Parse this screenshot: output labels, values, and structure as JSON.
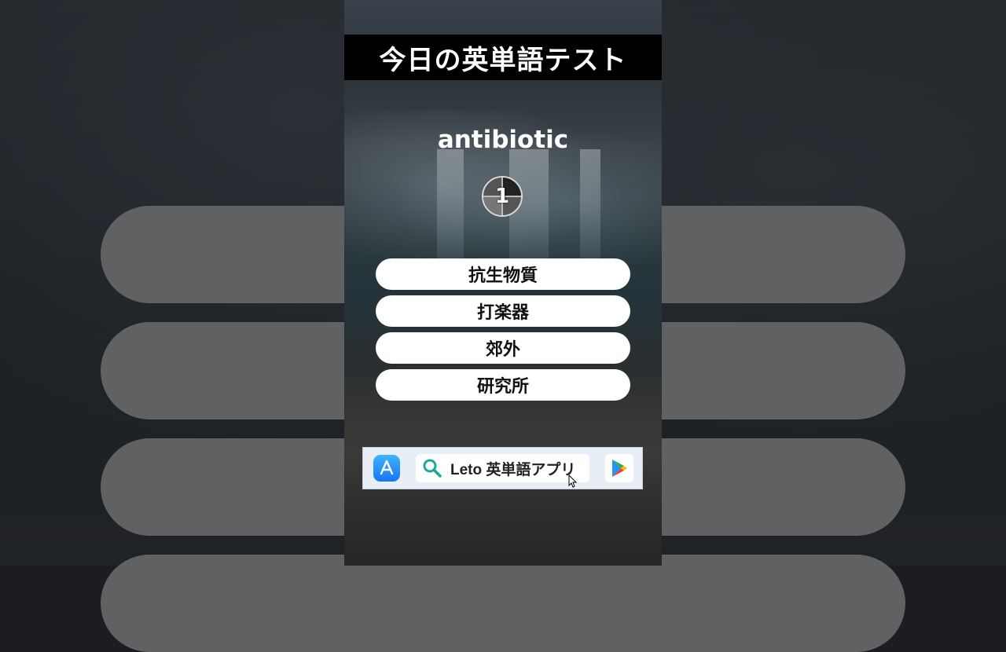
{
  "header": {
    "title": "今日の英単語テスト"
  },
  "quiz": {
    "word": "antibiotic",
    "countdown": "1",
    "choices": [
      "抗生物質",
      "打楽器",
      "郊外",
      "研究所"
    ]
  },
  "banner": {
    "search_text": "Leto 英単語アプリ",
    "left_icon": "app-store-icon",
    "right_icon": "google-play-icon"
  },
  "colors": {
    "title_bg": "#000000",
    "choice_bg": "#ffffff",
    "banner_bg": "#e8eef6",
    "search_icon": "#1aa89a",
    "app_store": "#1676f3"
  }
}
